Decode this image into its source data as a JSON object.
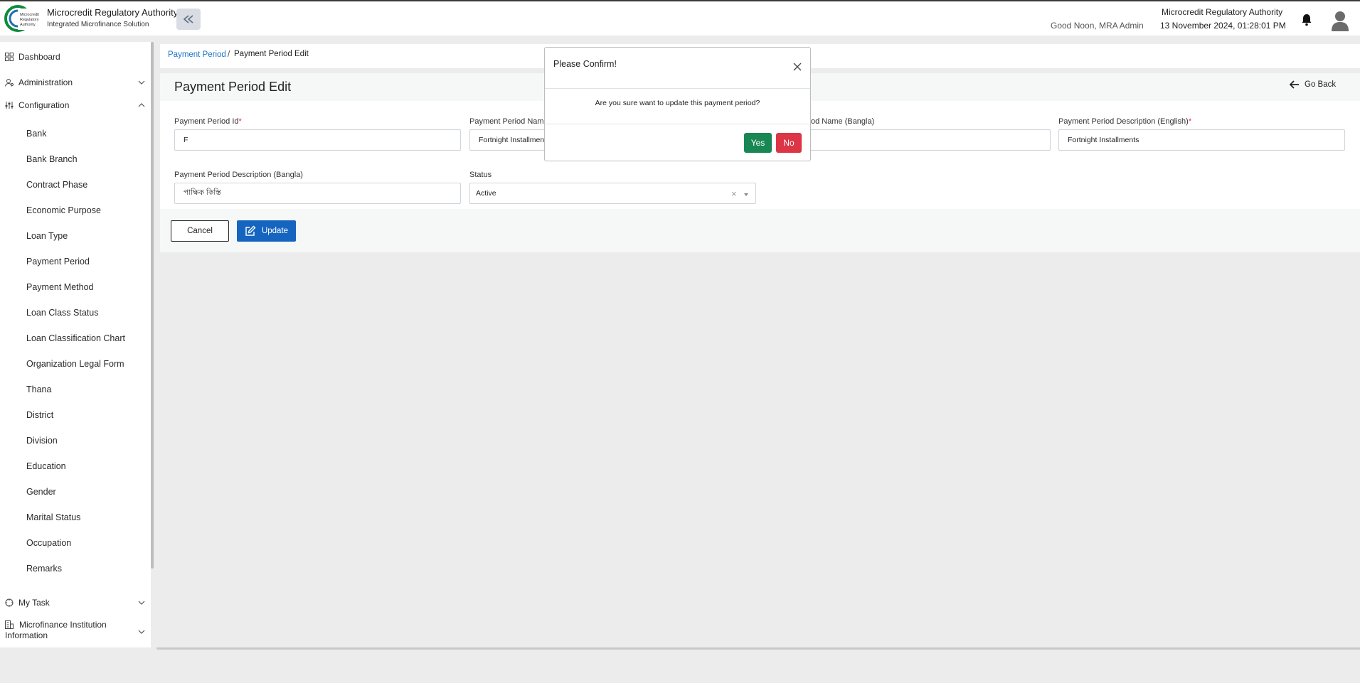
{
  "header": {
    "app_title": "Microcredit Regulatory Authority",
    "app_subtitle": "Integrated Microfinance Solution",
    "logo_text": "Microcredit Regulatory Authority",
    "greeting": "Good Noon, MRA Admin",
    "org_name": "Microcredit Regulatory Authority",
    "datetime": "13 November 2024, 01:28:01 PM"
  },
  "sidebar": {
    "dashboard": "Dashboard",
    "administration": "Administration",
    "configuration": "Configuration",
    "config_items": [
      "Bank",
      "Bank Branch",
      "Contract Phase",
      "Economic Purpose",
      "Loan Type",
      "Payment Period",
      "Payment Method",
      "Loan Class Status",
      "Loan Classification Chart",
      "Organization Legal Form",
      "Thana",
      "District",
      "Division",
      "Education",
      "Gender",
      "Marital Status",
      "Occupation",
      "Remarks"
    ],
    "my_task": "My Task",
    "mfi_info": "Microfinance Institution Information"
  },
  "breadcrumb": {
    "link": "Payment Period",
    "separator": "/",
    "current": "Payment Period Edit"
  },
  "page": {
    "title": "Payment Period Edit",
    "go_back": "Go Back"
  },
  "form": {
    "period_id_label": "Payment Period Id",
    "period_id_value": "F",
    "name_en_label": "Payment Period Name",
    "name_en_value": "Fortnight Installmen",
    "name_bn_label": "od Name (Bangla)",
    "desc_en_label": "Payment Period Description (English)",
    "desc_en_value": "Fortnight Installments",
    "desc_bn_label": "Payment Period Description (Bangla)",
    "desc_bn_value": "পাক্ষিক কিস্তি",
    "status_label": "Status",
    "status_value": "Active",
    "status_clear": "×",
    "required_mark": "*"
  },
  "actions": {
    "cancel": "Cancel",
    "update": "Update"
  },
  "modal": {
    "title": "Please Confirm!",
    "message": "Are you sure want to update this payment period?",
    "yes": "Yes",
    "no": "No"
  },
  "colors": {
    "primary": "#1565c0",
    "success": "#198754",
    "danger": "#dc3545",
    "link": "#1a73c9"
  }
}
